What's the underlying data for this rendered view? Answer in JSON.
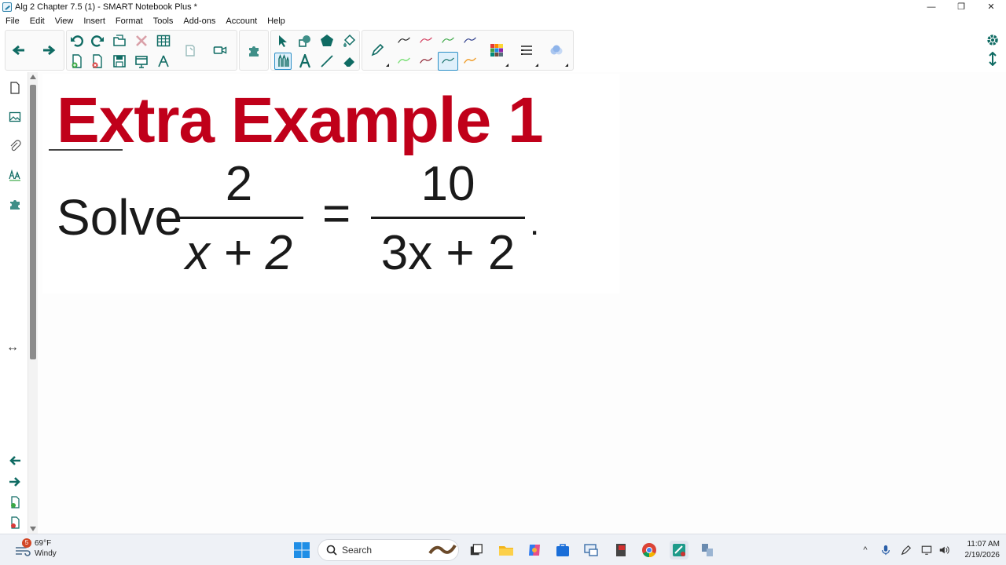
{
  "window": {
    "title": "Alg 2 Chapter 7.5 (1) - SMART Notebook Plus *",
    "minimize_glyph": "—",
    "restore_glyph": "❐",
    "close_glyph": "✕"
  },
  "menu": [
    "File",
    "Edit",
    "View",
    "Insert",
    "Format",
    "Tools",
    "Add-ons",
    "Account",
    "Help"
  ],
  "slide": {
    "title": "Extra Example 1",
    "solve_word": "Solve",
    "frac1_numerator": "2",
    "frac1_denominator": "x + 2",
    "equals": "=",
    "frac2_numerator": "10",
    "frac2_denominator": "3x + 2",
    "period": "."
  },
  "colors": {
    "title_red": "#c0001a",
    "icon_teal": "#0f6b63",
    "selection_blue": "#2b8fc7"
  },
  "taskbar": {
    "weather_badge": "5",
    "temperature": "69°F",
    "condition": "Windy",
    "search_label": "Search",
    "time": "11:07 AM",
    "date": "2/19/2026",
    "tray_chevron": "^"
  }
}
